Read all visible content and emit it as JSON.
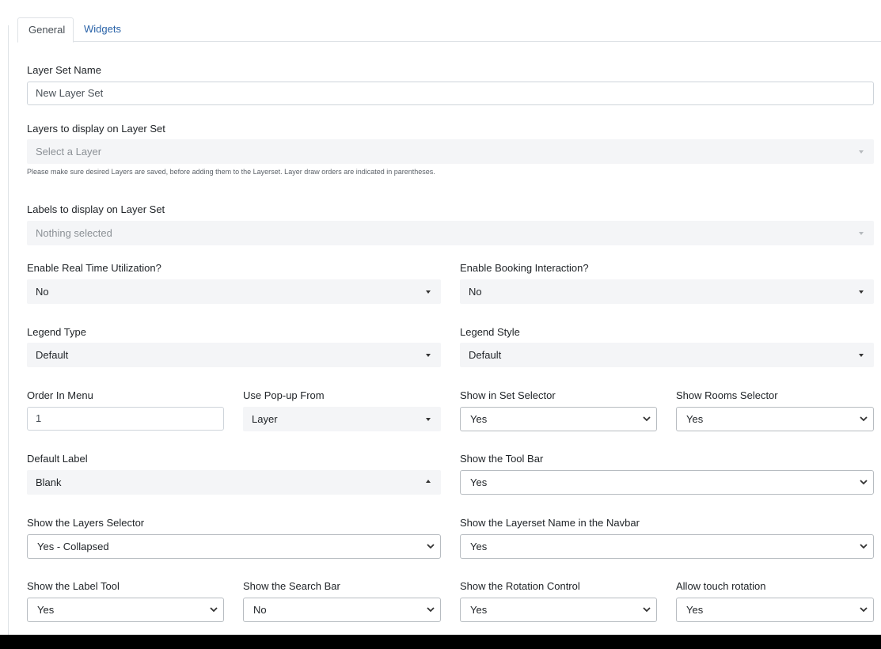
{
  "tabs": [
    "General",
    "Widgets"
  ],
  "fields": {
    "layer_set_name": {
      "label": "Layer Set Name",
      "value": "New Layer Set"
    },
    "layers": {
      "label": "Layers to display on Layer Set",
      "placeholder": "Select a Layer",
      "help": "Please make sure desired Layers are saved, before adding them to the Layerset. Layer draw orders are indicated in parentheses."
    },
    "labels": {
      "label": "Labels to display on Layer Set",
      "placeholder": "Nothing selected"
    },
    "real_time": {
      "label": "Enable Real Time Utilization?",
      "value": "No"
    },
    "booking": {
      "label": "Enable Booking Interaction?",
      "value": "No"
    },
    "legend_type": {
      "label": "Legend Type",
      "value": "Default"
    },
    "legend_style": {
      "label": "Legend Style",
      "value": "Default"
    },
    "order_in_menu": {
      "label": "Order In Menu",
      "value": "1"
    },
    "popup_from": {
      "label": "Use Pop-up From",
      "value": "Layer"
    },
    "set_selector": {
      "label": "Show in Set Selector",
      "value": "Yes"
    },
    "rooms_selector": {
      "label": "Show Rooms Selector",
      "value": "Yes"
    },
    "default_label": {
      "label": "Default Label",
      "value": "Blank"
    },
    "tool_bar": {
      "label": "Show the Tool Bar",
      "value": "Yes"
    },
    "layers_selector": {
      "label": "Show the Layers Selector",
      "value": "Yes - Collapsed"
    },
    "layerset_name_navbar": {
      "label": "Show the Layerset Name in the Navbar",
      "value": "Yes"
    },
    "label_tool": {
      "label": "Show the Label Tool",
      "value": "Yes"
    },
    "search_bar": {
      "label": "Show the Search Bar",
      "value": "No"
    },
    "rotation_control": {
      "label": "Show the Rotation Control",
      "value": "Yes"
    },
    "touch_rotation": {
      "label": "Allow touch rotation",
      "value": "Yes"
    }
  }
}
